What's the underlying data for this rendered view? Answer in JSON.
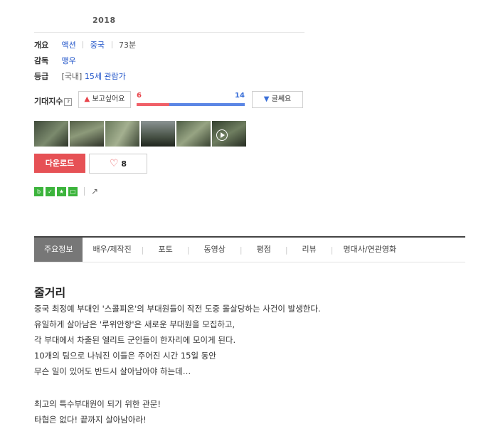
{
  "year": "2018",
  "overview": {
    "key": "개요",
    "genre": "액션",
    "country": "중국",
    "runtime": "73분"
  },
  "director": {
    "key": "감독",
    "name": "맹우"
  },
  "rating": {
    "key": "등급",
    "region": "[국내]",
    "value": "15세 관람가"
  },
  "expectation": {
    "label": "기대지수",
    "help": "?",
    "want_label": "보고싶어요",
    "dislike_label": "글쎄요",
    "want_count": "6",
    "dislike_count": "14",
    "want_ratio": 0.3,
    "colors": {
      "want": "#f06068",
      "dislike": "#5b86e5"
    }
  },
  "thumbnails": [
    {
      "name": "still-1"
    },
    {
      "name": "still-2"
    },
    {
      "name": "still-3"
    },
    {
      "name": "still-4"
    },
    {
      "name": "still-5"
    },
    {
      "name": "video-1"
    }
  ],
  "actions": {
    "download_label": "다운로드",
    "like_count": "8"
  },
  "share_icons": [
    "blog-share-icon",
    "talk-share-icon",
    "story-share-icon",
    "band-share-icon",
    "share-icon"
  ],
  "tabs": [
    "주요정보",
    "배우/제작진",
    "포토",
    "동영상",
    "평점",
    "리뷰",
    "명대사/연관영화"
  ],
  "synopsis": {
    "title": "줄거리",
    "lines": [
      "중국 최정예 부대인 '스콜피온'의 부대원들이 작전 도중 몰살당하는 사건이 발생한다.",
      " 유일하게 살아남은 '루위안항'은 새로운 부대원을 모집하고,",
      " 각 부대에서 차출된 엘리트 군인들이 한자리에 모이게 된다.",
      " 10개의 팀으로 나눠진 이들은 주어진 시간 15일 동안",
      " 무슨 일이 있어도 반드시 살아남아야 하는데…",
      "",
      " 최고의 특수부대원이 되기 위한 관문!",
      " 타협은 없다! 끝까지 살아남아라!"
    ]
  }
}
